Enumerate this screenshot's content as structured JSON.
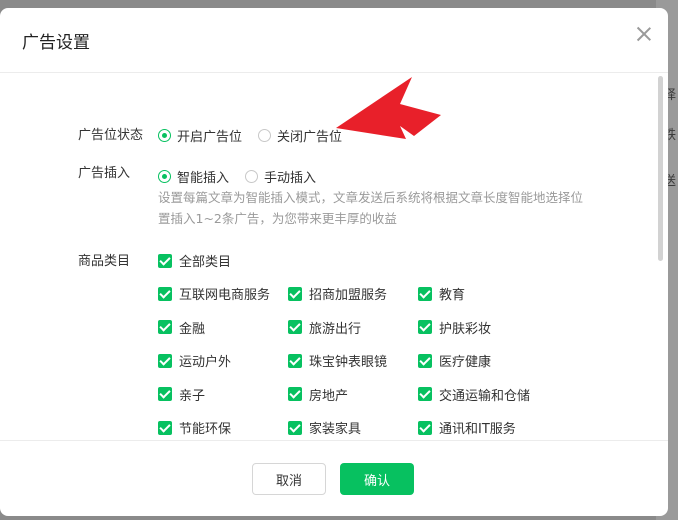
{
  "backdrop": {
    "side_chars": [
      "择",
      "铁",
      "送"
    ]
  },
  "dialog": {
    "title": "广告设置",
    "ad_status": {
      "label": "广告位状态",
      "options": [
        {
          "label": "开启广告位",
          "checked": true
        },
        {
          "label": "关闭广告位",
          "checked": false
        }
      ]
    },
    "ad_insert": {
      "label": "广告插入",
      "options": [
        {
          "label": "智能插入",
          "checked": true
        },
        {
          "label": "手动插入",
          "checked": false
        }
      ],
      "description": "设置每篇文章为智能插入模式，文章发送后系统将根据文章长度智能地选择位置插入1~2条广告，为您带来更丰厚的收益"
    },
    "category": {
      "label": "商品类目",
      "all_label": "全部类目",
      "items": [
        "互联网电商服务",
        "招商加盟服务",
        "教育",
        "金融",
        "旅游出行",
        "护肤彩妆",
        "运动户外",
        "珠宝钟表眼镜",
        "医疗健康",
        "亲子",
        "房地产",
        "交通运输和仓储",
        "节能环保",
        "家装家具",
        "通讯和IT服务"
      ]
    },
    "footer": {
      "cancel_label": "取消",
      "confirm_label": "确认"
    }
  },
  "colors": {
    "accent": "#07c160",
    "annotation_arrow": "#e8202a"
  }
}
